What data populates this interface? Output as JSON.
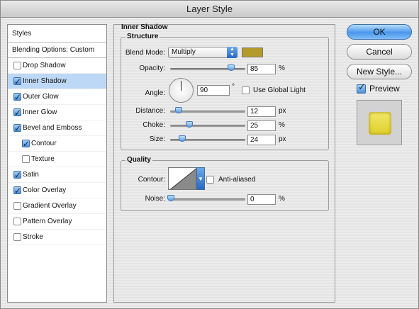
{
  "window": {
    "title": "Layer Style"
  },
  "styles_list": {
    "header": "Styles",
    "blending": "Blending Options: Custom",
    "items": [
      {
        "label": "Drop Shadow",
        "checked": false,
        "sub": false,
        "selected": false
      },
      {
        "label": "Inner Shadow",
        "checked": true,
        "sub": false,
        "selected": true
      },
      {
        "label": "Outer Glow",
        "checked": true,
        "sub": false,
        "selected": false
      },
      {
        "label": "Inner Glow",
        "checked": true,
        "sub": false,
        "selected": false
      },
      {
        "label": "Bevel and Emboss",
        "checked": true,
        "sub": false,
        "selected": false
      },
      {
        "label": "Contour",
        "checked": true,
        "sub": true,
        "selected": false
      },
      {
        "label": "Texture",
        "checked": false,
        "sub": true,
        "selected": false
      },
      {
        "label": "Satin",
        "checked": true,
        "sub": false,
        "selected": false
      },
      {
        "label": "Color Overlay",
        "checked": true,
        "sub": false,
        "selected": false
      },
      {
        "label": "Gradient Overlay",
        "checked": false,
        "sub": false,
        "selected": false
      },
      {
        "label": "Pattern Overlay",
        "checked": false,
        "sub": false,
        "selected": false
      },
      {
        "label": "Stroke",
        "checked": false,
        "sub": false,
        "selected": false
      }
    ]
  },
  "inner_shadow": {
    "title": "Inner Shadow",
    "structure": {
      "title": "Structure",
      "blend_mode_label": "Blend Mode:",
      "blend_mode_value": "Multiply",
      "color": "#b49a2a",
      "opacity_label": "Opacity:",
      "opacity_value": "85",
      "opacity_unit": "%",
      "angle_label": "Angle:",
      "angle_value": "90",
      "angle_unit": "°",
      "use_global_light_label": "Use Global Light",
      "distance_label": "Distance:",
      "distance_value": "12",
      "distance_unit": "px",
      "choke_label": "Choke:",
      "choke_value": "25",
      "choke_unit": "%",
      "size_label": "Size:",
      "size_value": "24",
      "size_unit": "px"
    },
    "quality": {
      "title": "Quality",
      "contour_label": "Contour:",
      "anti_aliased_label": "Anti-aliased",
      "noise_label": "Noise:",
      "noise_value": "0",
      "noise_unit": "%"
    }
  },
  "buttons": {
    "ok": "OK",
    "cancel": "Cancel",
    "new_style": "New Style...",
    "preview_label": "Preview"
  }
}
